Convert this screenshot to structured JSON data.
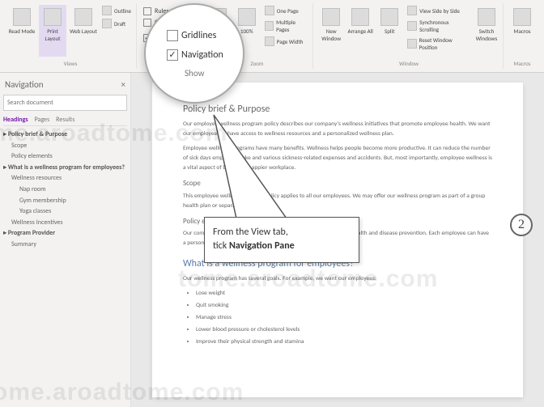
{
  "ribbon": {
    "views_group_label": "Views",
    "show_group_label": "Show",
    "zoom_group_label": "Zoom",
    "window_group_label": "Window",
    "macros_group_label": "Macros",
    "read_mode": "Read Mode",
    "print_layout": "Print Layout",
    "web_layout": "Web Layout",
    "outline": "Outline",
    "draft": "Draft",
    "ruler": "Ruler",
    "gridlines": "Gridlines",
    "navigation": "Navigation Pane",
    "zoom": "Zoom",
    "hundred": "100%",
    "one_page": "One Page",
    "multi_pages": "Multiple Pages",
    "page_width": "Page Width",
    "new_window": "New Window",
    "arrange_all": "Arrange All",
    "split": "Split",
    "side_by_side": "View Side by Side",
    "sync_scroll": "Synchronous Scrolling",
    "reset_pos": "Reset Window Position",
    "switch_windows": "Switch Windows",
    "macros": "Macros"
  },
  "magnifier": {
    "gridlines": "Gridlines",
    "navigation": "Navigation",
    "show": "Show"
  },
  "navpane": {
    "title": "Navigation",
    "search_placeholder": "Search document",
    "tab_headings": "Headings",
    "tab_pages": "Pages",
    "tab_results": "Results",
    "items": [
      {
        "lvl": 1,
        "label": "Policy brief & Purpose"
      },
      {
        "lvl": 2,
        "label": "Scope"
      },
      {
        "lvl": 2,
        "label": "Policy elements"
      },
      {
        "lvl": 1,
        "label": "What is a wellness program for employees?"
      },
      {
        "lvl": 2,
        "label": "Wellness resources"
      },
      {
        "lvl": 3,
        "label": "Nap room"
      },
      {
        "lvl": 3,
        "label": "Gym membership"
      },
      {
        "lvl": 3,
        "label": "Yoga classes"
      },
      {
        "lvl": 2,
        "label": "Wellness Incentives"
      },
      {
        "lvl": 1,
        "label": "Program Provider"
      },
      {
        "lvl": 2,
        "label": "Summary"
      }
    ]
  },
  "doc": {
    "h1": "Policy brief & Purpose",
    "p1": "Our employee wellness program policy describes our company's wellness initiatives that promote employee health. We want our employees to have access to wellness resources and a personalized wellness plan.",
    "p2": "Employee wellness programs have many benefits. Wellness helps people become more productive. It can reduce the number of sick days employees take and various sickness-related expenses and accidents. But, most importantly, employee wellness is a vital aspect of building a happier workplace.",
    "h3_scope": "Scope",
    "p3": "This employee wellness program policy applies to all our employees. We may offer our wellness program as part of a group health plan or separately.",
    "h3_elem": "Policy elements",
    "p4": "Our company provides a wellness program that promotes employee health and disease prevention. Each employee can have a personalized wellness plan and a variety of wellness resources.",
    "h2": "What is a wellness program for employees?",
    "p5": "Our wellness program has several goals. For example, we want our employees:",
    "bullets": [
      "Lose weight",
      "Quit smoking",
      "Manage stress",
      "Lower blood pressure or cholesterol levels",
      "Improve their physical strength and stamina"
    ]
  },
  "callout": {
    "line1": "From the View tab,",
    "line2a": "tick ",
    "line2b": "Navigation Pane"
  },
  "step": "2",
  "watermark": "tome.aroadtome.com"
}
